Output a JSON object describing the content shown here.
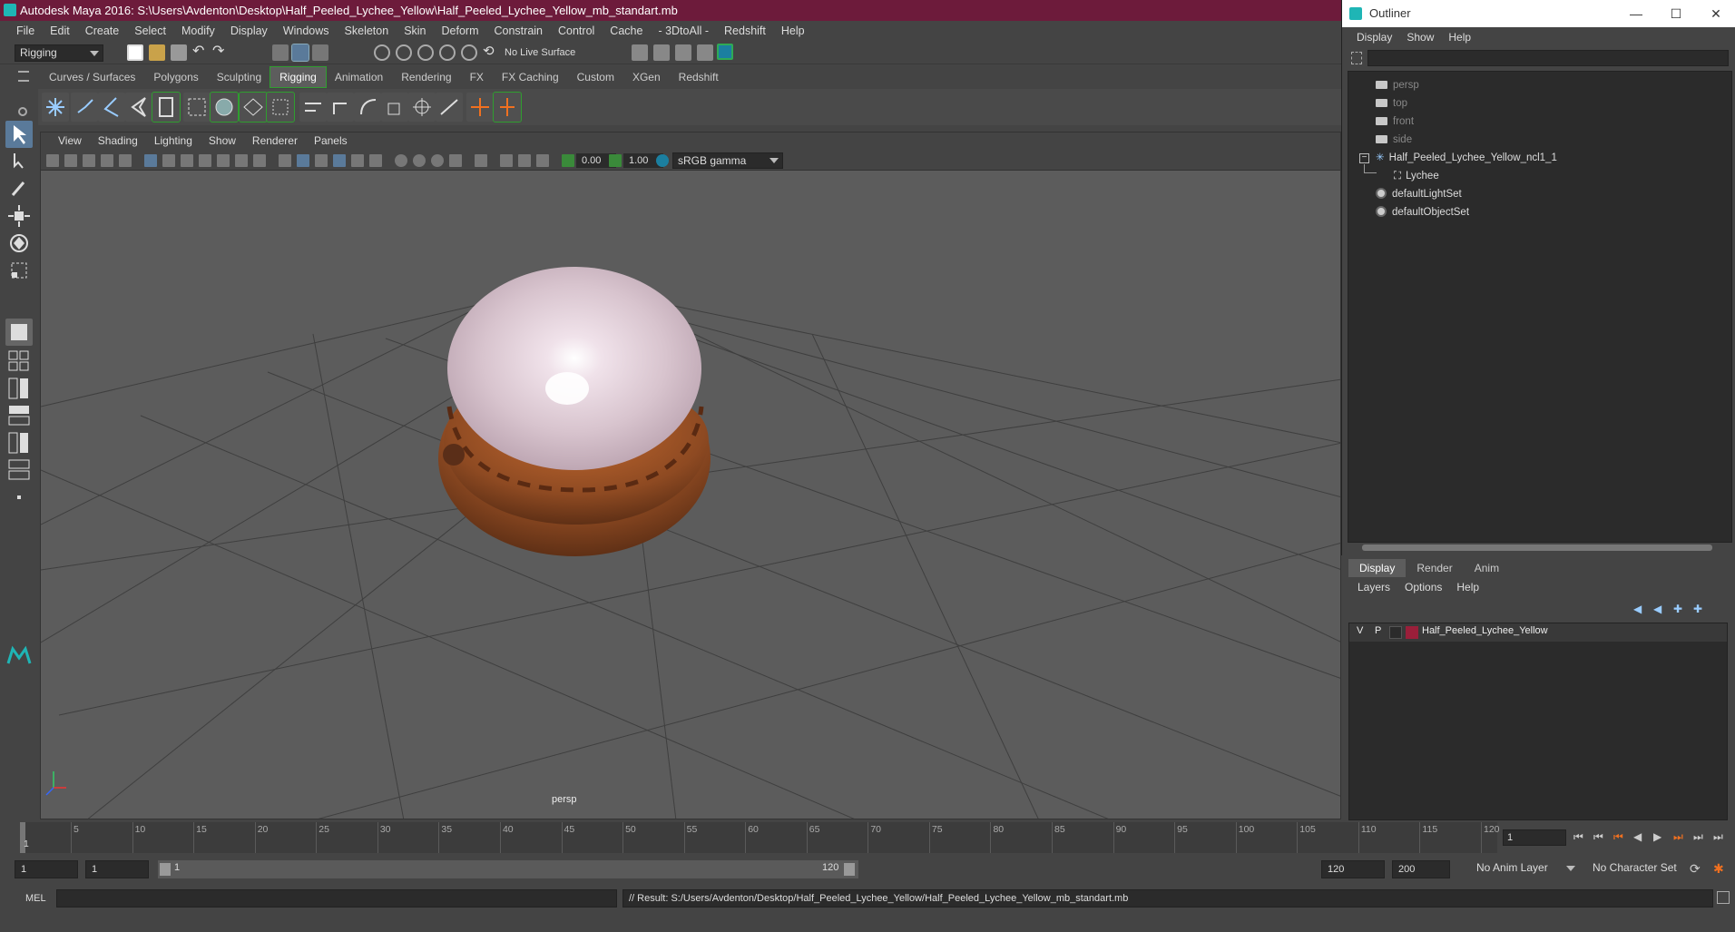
{
  "title_bar": {
    "text": "Autodesk Maya 2016: S:\\Users\\Avdenton\\Desktop\\Half_Peeled_Lychee_Yellow\\Half_Peeled_Lychee_Yellow_mb_standart.mb"
  },
  "menu": [
    "File",
    "Edit",
    "Create",
    "Select",
    "Modify",
    "Display",
    "Windows",
    "Skeleton",
    "Skin",
    "Deform",
    "Constrain",
    "Control",
    "Cache",
    "- 3DtoAll -",
    "Redshift",
    "Help"
  ],
  "status_line": {
    "mode": "Rigging",
    "live_surface": "No Live Surface"
  },
  "shelf": {
    "tabs": [
      "Curves / Surfaces",
      "Polygons",
      "Sculpting",
      "Rigging",
      "Animation",
      "Rendering",
      "FX",
      "FX Caching",
      "Custom",
      "XGen",
      "Redshift"
    ],
    "active_tab": "Rigging"
  },
  "viewport": {
    "menu": [
      "View",
      "Shading",
      "Lighting",
      "Show",
      "Renderer",
      "Panels"
    ],
    "exposure": "0.00",
    "gamma": "1.00",
    "color_space": "sRGB gamma",
    "camera_label": "persp"
  },
  "outliner": {
    "title": "Outliner",
    "menu": [
      "Display",
      "Show",
      "Help"
    ],
    "items": [
      {
        "label": "persp",
        "icon": "camera-icon",
        "dim": true
      },
      {
        "label": "top",
        "icon": "camera-icon",
        "dim": true
      },
      {
        "label": "front",
        "icon": "camera-icon",
        "dim": true
      },
      {
        "label": "side",
        "icon": "camera-icon",
        "dim": true
      },
      {
        "label": "Half_Peeled_Lychee_Yellow_ncl1_1",
        "icon": "group-icon",
        "dim": false
      },
      {
        "label": "Lychee",
        "icon": "mesh-icon",
        "dim": false
      },
      {
        "label": "defaultLightSet",
        "icon": "set-icon",
        "dim": false
      },
      {
        "label": "defaultObjectSet",
        "icon": "set-icon",
        "dim": false
      }
    ]
  },
  "layers": {
    "tabs": [
      "Display",
      "Render",
      "Anim"
    ],
    "active_tab": "Display",
    "menu": [
      "Layers",
      "Options",
      "Help"
    ],
    "rows": [
      {
        "v": "V",
        "p": "P",
        "name": "Half_Peeled_Lychee_Yellow",
        "color": "#9a1f3a"
      }
    ]
  },
  "timeline": {
    "ticks": [
      "5",
      "10",
      "15",
      "20",
      "25",
      "30",
      "35",
      "40",
      "45",
      "50",
      "55",
      "60",
      "65",
      "70",
      "75",
      "80",
      "85",
      "90",
      "95",
      "100",
      "105",
      "110",
      "115",
      "120"
    ],
    "start_marker": "1",
    "current_frame": "1"
  },
  "range": {
    "start": "1",
    "playback_start": "1",
    "slider_start": "1",
    "slider_end": "120",
    "playback_end": "120",
    "end": "200",
    "anim_layer": "No Anim Layer",
    "character_set": "No Character Set"
  },
  "command": {
    "lang": "MEL",
    "result": "// Result: S:/Users/Avdenton/Desktop/Half_Peeled_Lychee_Yellow/Half_Peeled_Lychee_Yellow_mb_standart.mb"
  },
  "colors": {
    "title_bar": "#6d1b3b",
    "shelf_active": "#2f9e2f",
    "accent": "#1fb5b5"
  }
}
